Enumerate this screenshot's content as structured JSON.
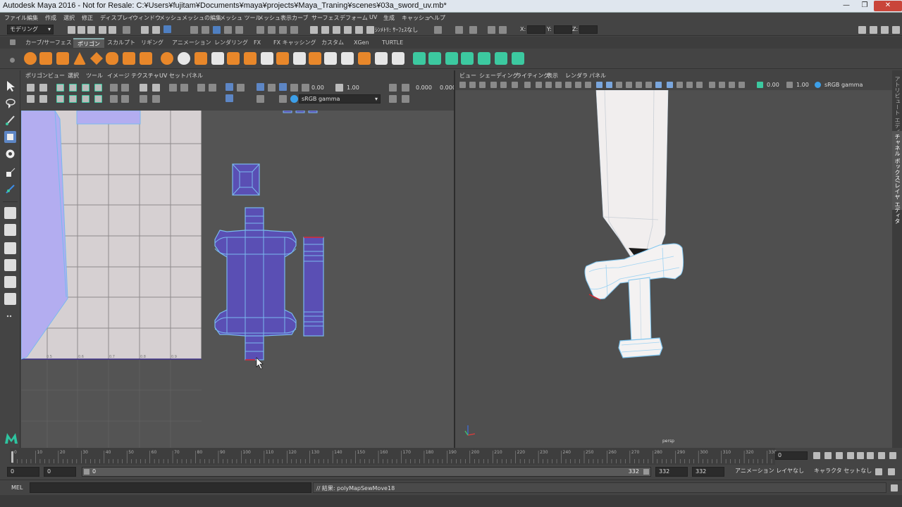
{
  "window": {
    "title": "Autodesk Maya 2016 - Not for Resale: C:¥Users¥fujitam¥Documents¥maya¥projects¥Maya_Traning¥scenes¥03a_sword_uv.mb*",
    "minimize": "—",
    "maximize": "❐",
    "close": "✕"
  },
  "menubar": [
    "ファイル",
    "編集",
    "作成",
    "選択",
    "修正",
    "ディスプレイ",
    "ウィンドウ",
    "メッシュ",
    "メッシュの編集",
    "メッシュ ツール",
    "メッシュ表示",
    "カーブ",
    "サーフェス",
    "デフォーム",
    "UV",
    "生成",
    "キャッシュ",
    "ヘルプ"
  ],
  "statusline": {
    "mode": "モデリング",
    "symmetry": "ｼﾝﾒﾄﾘ: ｵﾌ",
    "symmetry_full": "ｼﾝﾒﾄﾘ: ｻｰﾌｪｽなし",
    "x_label": "X:",
    "y_label": "Y:",
    "z_label": "Z:"
  },
  "shelf": {
    "tabs": [
      "カーブ/サーフェス",
      "ポリゴン",
      "スカルプト",
      "リギング",
      "アニメーション",
      "レンダリング",
      "FX",
      "FX キャッシング",
      "カスタム",
      "XGen",
      "TURTLE"
    ],
    "active_tab": "ポリゴン",
    "colors": {
      "orange": "#e8872a",
      "teal": "#3cc9a0",
      "white": "#e6e6e6"
    }
  },
  "uv_editor": {
    "menu": [
      "ポリゴン",
      "ビュー",
      "選択",
      "ツール",
      "イメージ",
      "テクスチャ",
      "UV セット",
      "パネル"
    ],
    "exposure": "0.00",
    "gamma": "1.00",
    "color_space": "sRGB gamma",
    "num_a": "0.000",
    "num_b": "0.000",
    "grid_labels": [
      "0.5",
      "0.6",
      "0.7",
      "0.8",
      "0.9"
    ]
  },
  "viewport": {
    "menu": [
      "ビュー",
      "シェーディング",
      "ライティング",
      "表示",
      "レンダラ",
      "パネル"
    ],
    "exposure": "0.00",
    "gamma": "1.00",
    "color_space": "sRGB gamma",
    "camera": "persp"
  },
  "right_strip": {
    "tab1": "アトリビュート エディタ",
    "tab2": "チャネル ボックス/レイヤ エディタ"
  },
  "timeline": {
    "ticks": [
      "0",
      "10",
      "20",
      "30",
      "40",
      "50",
      "60",
      "70",
      "80",
      "90",
      "100",
      "110",
      "120",
      "130",
      "140",
      "150",
      "160",
      "170",
      "180",
      "190",
      "200",
      "210",
      "220",
      "230",
      "240",
      "250",
      "260",
      "270",
      "280",
      "290",
      "300",
      "310",
      "320",
      "330"
    ],
    "current_frame": "0",
    "start_label": "0"
  },
  "range": {
    "start": "0",
    "anim_start": "0",
    "slider_start": "0",
    "slider_end": "332",
    "anim_end": "332",
    "end": "332",
    "anim_layer": "アニメーション レイヤなし",
    "char_set": "キャラクタ セットなし"
  },
  "command": {
    "lang": "MEL",
    "result": "// 結果: polyMapSewMove18"
  },
  "colors": {
    "uv_fill": "#5a4fb4",
    "uv_edge": "#79b9ee",
    "uv_canvas": "#d6d0d2",
    "mesh_white": "#f2f2f2",
    "border_red": "#d8222e"
  }
}
